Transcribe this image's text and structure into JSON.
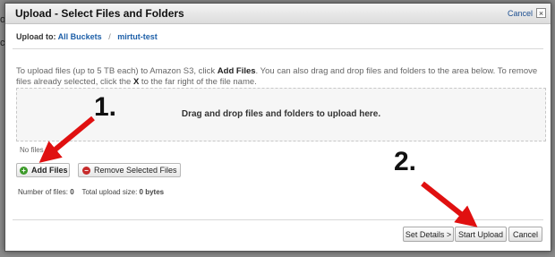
{
  "background": {
    "left_text_1": "o",
    "left_text_2": "c"
  },
  "dialog": {
    "title": "Upload - Select Files and Folders",
    "cancel_link": "Cancel",
    "close_glyph": "×",
    "breadcrumb": {
      "label": "Upload to:",
      "items": [
        "All Buckets",
        "mirtut-test"
      ],
      "separator": "/"
    },
    "instructions": {
      "part1": "To upload files (up to 5 TB each) to Amazon S3, click ",
      "add_files": "Add Files",
      "part2": ". You can also drag and drop files and folders to the area below. To remove files already selected, click the ",
      "x": "X",
      "part3": " to the far right of the file name."
    },
    "dropzone_text": "Drag and drop files and folders to upload here.",
    "no_files_text": "No files",
    "buttons": {
      "add_files": "Add Files",
      "remove_selected": "Remove Selected Files",
      "set_details": "Set Details >",
      "start_upload": "Start Upload",
      "cancel": "Cancel"
    },
    "stats": {
      "files_label": "Number of files:",
      "files_value": "0",
      "size_label": "Total upload size:",
      "size_value": "0 bytes"
    }
  },
  "annotations": {
    "step1": "1.",
    "step2": "2."
  },
  "colors": {
    "arrow": "#e01010",
    "add_icon": "#3d9a2a",
    "remove_icon": "#c62a2a",
    "link": "#1d5fa8"
  }
}
